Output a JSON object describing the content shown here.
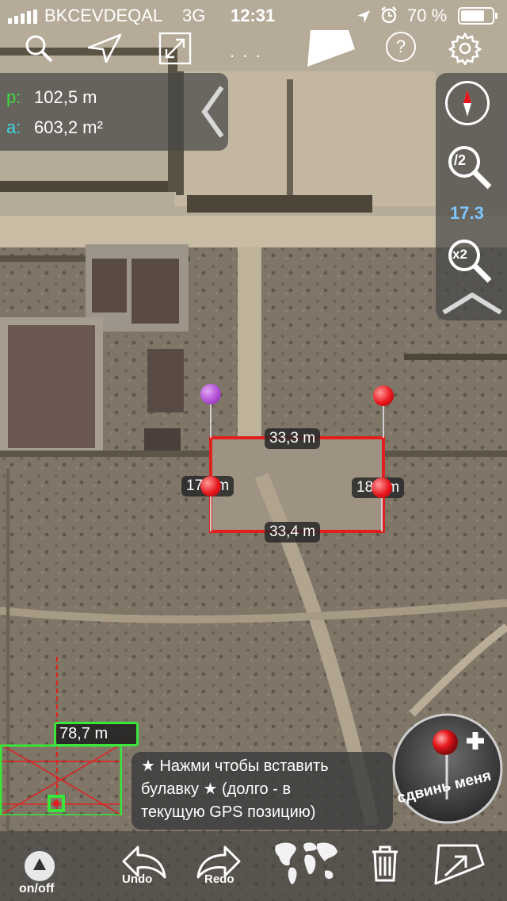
{
  "status_bar": {
    "carrier": "BKCEVDEQAL",
    "network": "3G",
    "time": "12:31",
    "battery": "70 %"
  },
  "toolbar": {
    "more_label": ". . .",
    "help_label": "?"
  },
  "measure": {
    "perimeter_label": "p:",
    "perimeter_value": "102,5 m",
    "area_label": "a:",
    "area_value": "603,2 m²"
  },
  "zoom": {
    "zoom_out_label": "/2",
    "level": "17.3",
    "zoom_in_label": "x2"
  },
  "segments": {
    "top": "33,3 m",
    "bottom": "33,4 m",
    "left": "17,",
    "left_suffix": "m",
    "right": "18,",
    "right_suffix": "m"
  },
  "minimap": {
    "distance": "78,7 m"
  },
  "hint": {
    "line1": "★ Нажми чтобы вставить",
    "line2": "булавку   ★ (долго - в",
    "line3": "текущую GPS позицию)"
  },
  "move_me": {
    "label": "сдвинь меня"
  },
  "bottom_bar": {
    "onoff_label": "on/off",
    "undo_label": "Undo",
    "redo_label": "Redo"
  },
  "colors": {
    "polygon": "#e02020",
    "pin_red": "#e8161b",
    "pin_purple": "#b04fd6",
    "perimeter_label": "#3fdc3f",
    "area_label": "#3fd6e0",
    "zoom_level": "#7fc6ff",
    "minimap_frame": "#39e639"
  }
}
